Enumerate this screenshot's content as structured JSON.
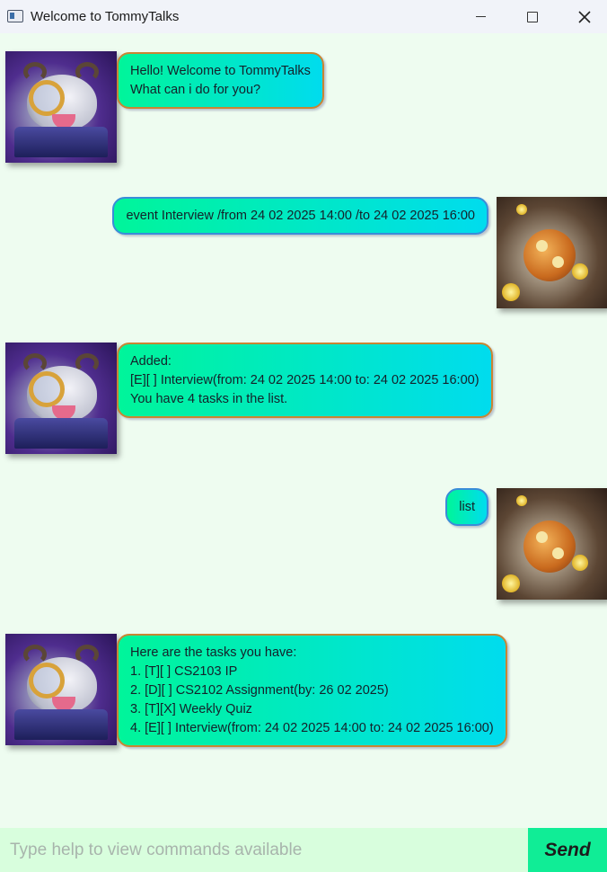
{
  "window": {
    "title": "Welcome to TommyTalks"
  },
  "chat": {
    "messages": [
      {
        "sender": "bot",
        "avatar": "poro-with-magnifier-avatar",
        "lines": [
          "Hello! Welcome to TommyTalks",
          "What can i do for you?"
        ]
      },
      {
        "sender": "user",
        "avatar": "golden-orb-avatar",
        "lines": [
          "event Interview /from 24 02 2025 14:00 /to 24 02 2025 16:00"
        ]
      },
      {
        "sender": "bot",
        "avatar": "poro-with-magnifier-avatar",
        "lines": [
          "Added:",
          "[E][ ] Interview(from: 24 02 2025 14:00 to: 24 02 2025 16:00)",
          "You have 4 tasks in the list."
        ]
      },
      {
        "sender": "user",
        "avatar": "golden-orb-avatar",
        "lines": [
          "list"
        ]
      },
      {
        "sender": "bot",
        "avatar": "poro-with-magnifier-avatar",
        "lines": [
          "Here are the tasks you have:",
          "1. [T][ ] CS2103 IP",
          "2. [D][ ] CS2102 Assignment(by: 26 02 2025)",
          "3. [T][X] Weekly Quiz",
          "4. [E][ ] Interview(from: 24 02 2025 14:00 to: 24 02 2025 16:00)"
        ]
      }
    ]
  },
  "input": {
    "placeholder": "Type help to view commands available",
    "value": ""
  },
  "send": {
    "label": "Send"
  },
  "colors": {
    "background": "#eefcf0",
    "bubble_gradient_start": "#00f59a",
    "bubble_gradient_end": "#00dcee",
    "bot_bubble_border": "#c98534",
    "user_bubble_border": "#3a8cd8",
    "input_background": "#d8fedd",
    "send_background": "#10ed96"
  }
}
